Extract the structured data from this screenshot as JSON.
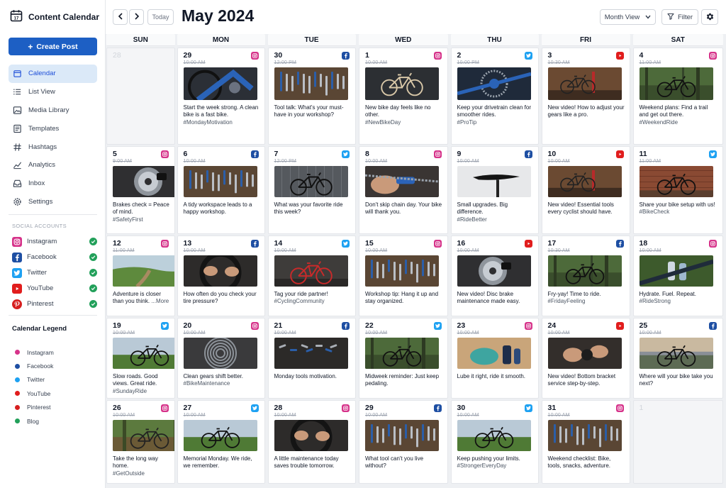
{
  "app": {
    "title": "Content Calendar"
  },
  "sidebar": {
    "create_label": "Create Post",
    "nav": [
      {
        "label": "Calendar",
        "icon": "calendar-icon",
        "active": true
      },
      {
        "label": "List View",
        "icon": "list-icon"
      },
      {
        "label": "Media Library",
        "icon": "image-icon"
      },
      {
        "label": "Templates",
        "icon": "template-icon"
      },
      {
        "label": "Hashtags",
        "icon": "hashtag-icon"
      },
      {
        "label": "Analytics",
        "icon": "analytics-icon"
      },
      {
        "label": "Inbox",
        "icon": "inbox-icon"
      },
      {
        "label": "Settings",
        "icon": "gear-icon"
      }
    ],
    "accounts_label": "SOCIAL ACCOUNTS",
    "accounts": [
      {
        "label": "Instagram",
        "network": "instagram",
        "connected": true
      },
      {
        "label": "Facebook",
        "network": "facebook",
        "connected": true
      },
      {
        "label": "Twitter",
        "network": "twitter",
        "connected": true
      },
      {
        "label": "YouTube",
        "network": "youtube",
        "connected": true
      },
      {
        "label": "Pinterest",
        "network": "pinterest",
        "connected": true
      }
    ],
    "legend_title": "Calendar Legend",
    "legend": [
      {
        "label": "Instagram",
        "color": "#d6338a"
      },
      {
        "label": "Facebook",
        "color": "#1e4fa3"
      },
      {
        "label": "Twitter",
        "color": "#1da1f2"
      },
      {
        "label": "YouTube",
        "color": "#e11d1d"
      },
      {
        "label": "Pinterest",
        "color": "#d61f1f"
      },
      {
        "label": "Blog",
        "color": "#22a05a"
      }
    ]
  },
  "header": {
    "today_label": "Today",
    "month_title": "May 2024",
    "view_label": "Month View",
    "filter_label": "Filter"
  },
  "colors": {
    "instagram": "#d6338a",
    "facebook": "#1e4fa3",
    "twitter": "#1da1f2",
    "youtube": "#e11d1d",
    "pinterest": "#d61f1f",
    "accent": "#1d5fc4"
  },
  "calendar": {
    "days_of_week": [
      "SUN",
      "MON",
      "TUE",
      "WED",
      "THU",
      "FRI",
      "SAT"
    ],
    "weeks": [
      [
        {
          "day": "28",
          "muted": true
        },
        {
          "day": "29",
          "time": "10:00 AM",
          "network": "instagram",
          "scene": "bike-closeup",
          "caption": "Start the week strong. A clean bike is a fast bike.",
          "tag": "#MondayMotivation"
        },
        {
          "day": "30",
          "time": "12:00 PM",
          "network": "facebook",
          "scene": "tools-board",
          "caption": "Tool talk: What's your must-have in your workshop?"
        },
        {
          "day": "1",
          "time": "10:00 AM",
          "network": "instagram",
          "scene": "bike-studio",
          "caption": "New bike day feels like no other.",
          "tag": "#NewBikeDay"
        },
        {
          "day": "2",
          "time": "10:00 PM",
          "network": "twitter",
          "scene": "drivetrain",
          "caption": "Keep your drivetrain clean for smoother rides.",
          "tag": "#ProTip"
        },
        {
          "day": "3",
          "time": "10:30 AM",
          "network": "youtube",
          "scene": "workshop-stand",
          "caption": "New video! How to adjust your gears like a pro."
        },
        {
          "day": "4",
          "time": "11:00 AM",
          "network": "instagram",
          "scene": "bike-forest",
          "caption": "Weekend plans: Find a trail and get out there.",
          "tag": "#WeekendRide"
        }
      ],
      [
        {
          "day": "5",
          "time": "9:00 AM",
          "network": "instagram",
          "scene": "brake-disc",
          "caption": "Brakes check = Peace of mind.",
          "tag": "#SafetyFirst"
        },
        {
          "day": "6",
          "time": "10:00 AM",
          "network": "facebook",
          "scene": "tools-board",
          "caption": "A tidy workspace leads to a happy workshop."
        },
        {
          "day": "7",
          "time": "12:00 PM",
          "network": "twitter",
          "scene": "bike-garage",
          "caption": "What was your favorite ride this week?"
        },
        {
          "day": "8",
          "time": "10:00 AM",
          "network": "instagram",
          "scene": "chain-hands",
          "caption": "Don't skip chain day. Your bike will thank you."
        },
        {
          "day": "9",
          "time": "10:00 AM",
          "network": "facebook",
          "scene": "saddle",
          "caption": "Small upgrades. Big difference.",
          "tag": "#RideBetter"
        },
        {
          "day": "10",
          "time": "10:00 AM",
          "network": "youtube",
          "scene": "workshop-stand",
          "caption": "New video! Essential tools every cyclist should have."
        },
        {
          "day": "11",
          "time": "11:00 AM",
          "network": "twitter",
          "scene": "bike-brick",
          "caption": "Share your bike setup with us!",
          "tag": "#BikeCheck"
        }
      ],
      [
        {
          "day": "12",
          "time": "11:00 AM",
          "network": "instagram",
          "scene": "trail-landscape",
          "caption": "Adventure is closer than you think.",
          "more": "...More"
        },
        {
          "day": "13",
          "time": "10:00 AM",
          "network": "facebook",
          "scene": "hands-tire",
          "caption": "How often do you check your tire pressure?"
        },
        {
          "day": "14",
          "time": "10:00 AM",
          "network": "twitter",
          "scene": "bike-red",
          "caption": "Tag your ride partner!",
          "tag": "#CyclingCommunity"
        },
        {
          "day": "15",
          "time": "10:00 AM",
          "network": "instagram",
          "scene": "tools-board",
          "caption": "Workshop tip: Hang it up and stay organized."
        },
        {
          "day": "16",
          "time": "10:00 AM",
          "network": "youtube",
          "scene": "brake-disc",
          "caption": "New video! Disc brake maintenance made easy."
        },
        {
          "day": "17",
          "time": "10:30 AM",
          "network": "facebook",
          "scene": "bike-forest",
          "caption": "Fry-yay! Time to ride.",
          "tag": "#FridayFeeling"
        },
        {
          "day": "18",
          "time": "10:00 AM",
          "network": "instagram",
          "scene": "bottles-bike",
          "caption": "Hydrate. Fuel. Repeat.",
          "tag": "#RideStrong"
        }
      ],
      [
        {
          "day": "19",
          "time": "10:00 AM",
          "network": "twitter",
          "scene": "bike-field",
          "caption": "Slow roads. Good views. Great ride.",
          "tag": "#SundayRide"
        },
        {
          "day": "20",
          "time": "10:00 AM",
          "network": "instagram",
          "scene": "cassette",
          "caption": "Clean gears shift better.",
          "tag": "#BikeMaintenance"
        },
        {
          "day": "21",
          "time": "10:00 AM",
          "network": "facebook",
          "scene": "tools-dark",
          "caption": "Monday tools motivation."
        },
        {
          "day": "22",
          "time": "10:00 AM",
          "network": "twitter",
          "scene": "bike-forest",
          "caption": "Midweek reminder: Just keep pedaling."
        },
        {
          "day": "23",
          "time": "10:00 AM",
          "network": "instagram",
          "scene": "lube-bottles",
          "caption": "Lube it right, ride it smooth."
        },
        {
          "day": "24",
          "time": "10:00 AM",
          "network": "youtube",
          "scene": "hands-bracket",
          "caption": "New video! Bottom bracket service step-by-step."
        },
        {
          "day": "25",
          "time": "10:00 AM",
          "network": "facebook",
          "scene": "bike-sunset",
          "caption": "Where will your bike take you next?"
        }
      ],
      [
        {
          "day": "26",
          "time": "10:00 AM",
          "network": "instagram",
          "scene": "bike-woods",
          "caption": "Take the long way home.",
          "tag": "#GetOutside"
        },
        {
          "day": "27",
          "time": "10:00 AM",
          "network": "twitter",
          "scene": "bike-field",
          "caption": "Memorial Monday. We ride, we remember."
        },
        {
          "day": "28",
          "time": "10:00 AM",
          "network": "instagram",
          "scene": "hands-tire",
          "caption": "A little maintenance today saves trouble tomorrow."
        },
        {
          "day": "29",
          "time": "10:00 AM",
          "network": "facebook",
          "scene": "tools-board",
          "caption": "What tool can't you live without?"
        },
        {
          "day": "30",
          "time": "10:00 AM",
          "network": "twitter",
          "scene": "bike-field",
          "caption": "Keep pushing your limits.",
          "tag": "#StrongerEveryDay"
        },
        {
          "day": "31",
          "time": "10:00 AM",
          "network": "instagram",
          "scene": "tools-board",
          "caption": "Weekend checklist: Bike, tools, snacks, adventure."
        },
        {
          "day": "1",
          "muted": true
        }
      ]
    ]
  }
}
